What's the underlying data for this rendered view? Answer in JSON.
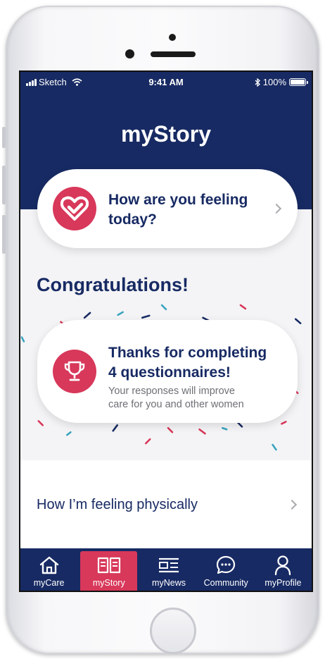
{
  "status_bar": {
    "carrier": "Sketch",
    "time": "9:41 AM",
    "battery": "100%"
  },
  "header": {
    "title": "myStory"
  },
  "feeling_card": {
    "line1": "How are you feeling",
    "line2": "today?",
    "icon": "heart-check-icon"
  },
  "congrats": {
    "heading": "Congratulations!"
  },
  "completion_card": {
    "line1": "Thanks for completing",
    "line2": "4 questionnaires!",
    "sub1": "Your responses will improve",
    "sub2": "care for you and other women",
    "icon": "trophy-icon"
  },
  "list": {
    "physical_label": "How I’m feeling physically"
  },
  "tabs": [
    {
      "label": "myCare",
      "icon": "home-icon"
    },
    {
      "label": "myStory",
      "icon": "book-icon",
      "active": true
    },
    {
      "label": "myNews",
      "icon": "news-icon"
    },
    {
      "label": "Community",
      "icon": "chat-bubble-icon"
    },
    {
      "label": "myProfile",
      "icon": "person-icon"
    }
  ],
  "colors": {
    "navy": "#172a63",
    "accent": "#d8385a",
    "background": "#f4f4f6",
    "confetti_teal": "#3aa3bf"
  }
}
